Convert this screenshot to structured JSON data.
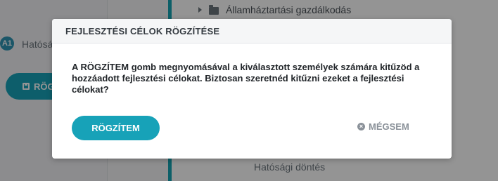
{
  "background": {
    "badge": "A1",
    "item_text": "Hatósá",
    "save_button_label": "RÖG",
    "tree_item_label": "Államháztartási gazdálkodás",
    "bottom_text": "Hatósági döntés"
  },
  "modal": {
    "title": "FEJLESZTÉSI CÉLOK RÖGZÍTÉSE",
    "message": "A RÖGZÍTEM gomb megnyomásával a kiválasztott személyek számára kitűzöd a hozzáadott fejlesztési célokat. Biztosan szeretnéd kitűzni ezeket a fejlesztési célokat?",
    "confirm_label": "RÖGZÍTEM",
    "cancel_label": "MÉGSEM"
  },
  "colors": {
    "accent": "#17a2b8",
    "overlay": "rgba(0,0,0,0.42)"
  }
}
